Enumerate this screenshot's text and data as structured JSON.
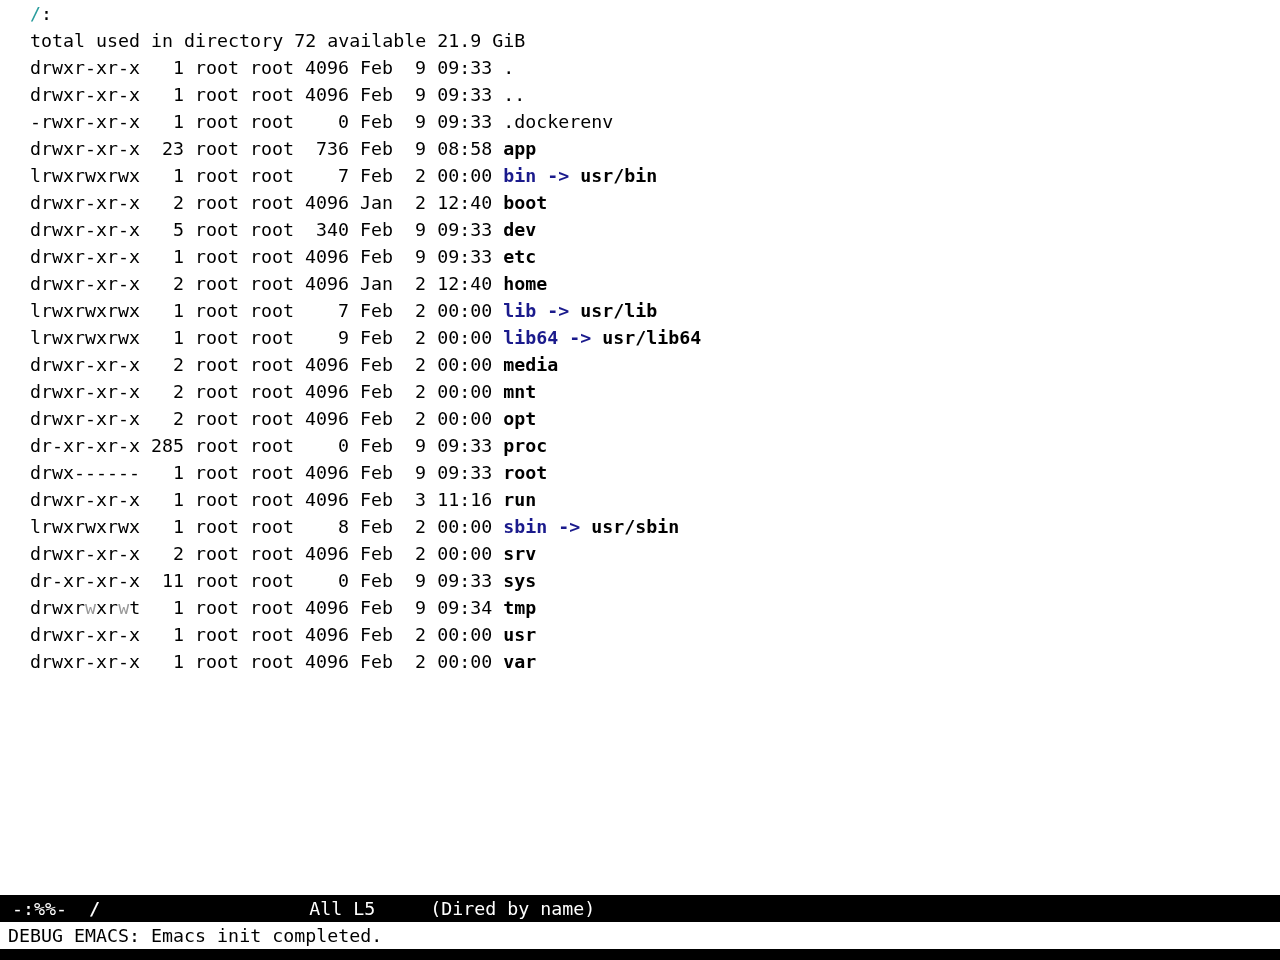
{
  "buffer": {
    "heading": {
      "directory": "/",
      "suffix": ":"
    },
    "summary": "total used in directory 72 available 21.9 GiB",
    "rows": [
      {
        "perms": "drwxr-xr-x",
        "links": "1",
        "owner": "root",
        "group": "root",
        "size": "4096",
        "month": "Feb",
        "day": "9",
        "time": "09:33",
        "name": ".",
        "kind": "plain",
        "group_other_writable": false
      },
      {
        "perms": "drwxr-xr-x",
        "links": "1",
        "owner": "root",
        "group": "root",
        "size": "4096",
        "month": "Feb",
        "day": "9",
        "time": "09:33",
        "name": "..",
        "kind": "plain",
        "group_other_writable": false
      },
      {
        "perms": "-rwxr-xr-x",
        "links": "1",
        "owner": "root",
        "group": "root",
        "size": "0",
        "month": "Feb",
        "day": "9",
        "time": "09:33",
        "name": ".dockerenv",
        "kind": "plain",
        "group_other_writable": false
      },
      {
        "perms": "drwxr-xr-x",
        "links": "23",
        "owner": "root",
        "group": "root",
        "size": "736",
        "month": "Feb",
        "day": "9",
        "time": "08:58",
        "name": "app",
        "kind": "dir",
        "group_other_writable": false
      },
      {
        "perms": "lrwxrwxrwx",
        "links": "1",
        "owner": "root",
        "group": "root",
        "size": "7",
        "month": "Feb",
        "day": "2",
        "time": "00:00",
        "name": "bin",
        "kind": "link",
        "arrow": "->",
        "target": "usr/bin",
        "group_other_writable": false
      },
      {
        "perms": "drwxr-xr-x",
        "links": "2",
        "owner": "root",
        "group": "root",
        "size": "4096",
        "month": "Jan",
        "day": "2",
        "time": "12:40",
        "name": "boot",
        "kind": "dir",
        "group_other_writable": false
      },
      {
        "perms": "drwxr-xr-x",
        "links": "5",
        "owner": "root",
        "group": "root",
        "size": "340",
        "month": "Feb",
        "day": "9",
        "time": "09:33",
        "name": "dev",
        "kind": "dir",
        "group_other_writable": false
      },
      {
        "perms": "drwxr-xr-x",
        "links": "1",
        "owner": "root",
        "group": "root",
        "size": "4096",
        "month": "Feb",
        "day": "9",
        "time": "09:33",
        "name": "etc",
        "kind": "dir",
        "group_other_writable": false
      },
      {
        "perms": "drwxr-xr-x",
        "links": "2",
        "owner": "root",
        "group": "root",
        "size": "4096",
        "month": "Jan",
        "day": "2",
        "time": "12:40",
        "name": "home",
        "kind": "dir",
        "group_other_writable": false
      },
      {
        "perms": "lrwxrwxrwx",
        "links": "1",
        "owner": "root",
        "group": "root",
        "size": "7",
        "month": "Feb",
        "day": "2",
        "time": "00:00",
        "name": "lib",
        "kind": "link",
        "arrow": "->",
        "target": "usr/lib",
        "group_other_writable": false
      },
      {
        "perms": "lrwxrwxrwx",
        "links": "1",
        "owner": "root",
        "group": "root",
        "size": "9",
        "month": "Feb",
        "day": "2",
        "time": "00:00",
        "name": "lib64",
        "kind": "link",
        "arrow": "->",
        "target": "usr/lib64",
        "group_other_writable": false
      },
      {
        "perms": "drwxr-xr-x",
        "links": "2",
        "owner": "root",
        "group": "root",
        "size": "4096",
        "month": "Feb",
        "day": "2",
        "time": "00:00",
        "name": "media",
        "kind": "dir",
        "group_other_writable": false
      },
      {
        "perms": "drwxr-xr-x",
        "links": "2",
        "owner": "root",
        "group": "root",
        "size": "4096",
        "month": "Feb",
        "day": "2",
        "time": "00:00",
        "name": "mnt",
        "kind": "dir",
        "group_other_writable": false
      },
      {
        "perms": "drwxr-xr-x",
        "links": "2",
        "owner": "root",
        "group": "root",
        "size": "4096",
        "month": "Feb",
        "day": "2",
        "time": "00:00",
        "name": "opt",
        "kind": "dir",
        "group_other_writable": false
      },
      {
        "perms": "dr-xr-xr-x",
        "links": "285",
        "owner": "root",
        "group": "root",
        "size": "0",
        "month": "Feb",
        "day": "9",
        "time": "09:33",
        "name": "proc",
        "kind": "dir",
        "group_other_writable": false
      },
      {
        "perms": "drwx------",
        "links": "1",
        "owner": "root",
        "group": "root",
        "size": "4096",
        "month": "Feb",
        "day": "9",
        "time": "09:33",
        "name": "root",
        "kind": "dir",
        "group_other_writable": false
      },
      {
        "perms": "drwxr-xr-x",
        "links": "1",
        "owner": "root",
        "group": "root",
        "size": "4096",
        "month": "Feb",
        "day": "3",
        "time": "11:16",
        "name": "run",
        "kind": "dir",
        "group_other_writable": false
      },
      {
        "perms": "lrwxrwxrwx",
        "links": "1",
        "owner": "root",
        "group": "root",
        "size": "8",
        "month": "Feb",
        "day": "2",
        "time": "00:00",
        "name": "sbin",
        "kind": "link",
        "arrow": "->",
        "target": "usr/sbin",
        "group_other_writable": false
      },
      {
        "perms": "drwxr-xr-x",
        "links": "2",
        "owner": "root",
        "group": "root",
        "size": "4096",
        "month": "Feb",
        "day": "2",
        "time": "00:00",
        "name": "srv",
        "kind": "dir",
        "group_other_writable": false
      },
      {
        "perms": "dr-xr-xr-x",
        "links": "11",
        "owner": "root",
        "group": "root",
        "size": "0",
        "month": "Feb",
        "day": "9",
        "time": "09:33",
        "name": "sys",
        "kind": "dir",
        "group_other_writable": false
      },
      {
        "perms": "drwxrwxrwt",
        "links": "1",
        "owner": "root",
        "group": "root",
        "size": "4096",
        "month": "Feb",
        "day": "9",
        "time": "09:34",
        "name": "tmp",
        "kind": "dir",
        "group_other_writable": true
      },
      {
        "perms": "drwxr-xr-x",
        "links": "1",
        "owner": "root",
        "group": "root",
        "size": "4096",
        "month": "Feb",
        "day": "2",
        "time": "00:00",
        "name": "usr",
        "kind": "dir",
        "group_other_writable": false
      },
      {
        "perms": "drwxr-xr-x",
        "links": "1",
        "owner": "root",
        "group": "root",
        "size": "4096",
        "month": "Feb",
        "day": "2",
        "time": "00:00",
        "name": "var",
        "kind": "dir",
        "group_other_writable": false
      }
    ]
  },
  "mode_line": {
    "status": "-:%%-",
    "buffer_name": "/",
    "position": "All L5",
    "mode": "(Dired by name)"
  },
  "echo_area": "DEBUG EMACS: Emacs init completed."
}
